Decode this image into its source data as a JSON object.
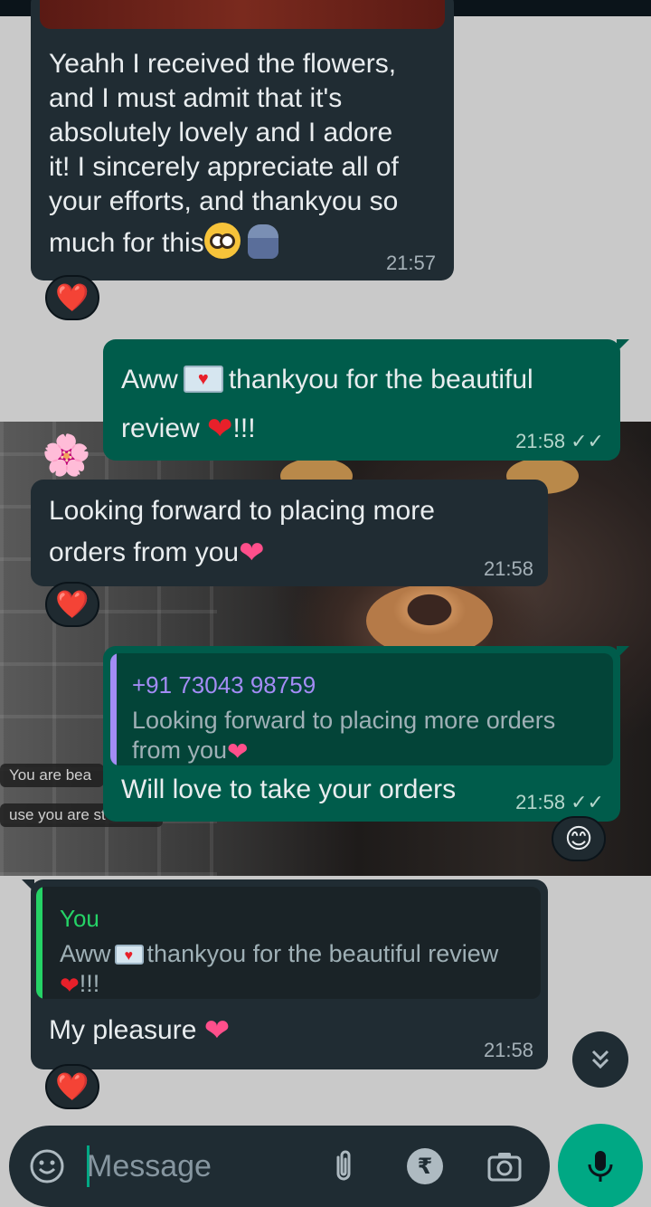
{
  "messages": [
    {
      "id": "m1",
      "direction": "incoming",
      "lines": [
        "Yeahh I received the flowers,",
        "and I must admit that it's",
        "absolutely lovely and I adore",
        "it! I sincerely appreciate all of",
        "your efforts, and thankyou so",
        "much for this"
      ],
      "time": "21:57",
      "reaction": "❤️"
    },
    {
      "id": "m2",
      "direction": "outgoing",
      "line1_pre": "Aww",
      "line1_post": "thankyou for the beautiful",
      "line2_pre": "review",
      "line2_post": "!!!",
      "time": "21:58",
      "status": "read"
    },
    {
      "id": "m3",
      "direction": "incoming",
      "line1": "Looking forward to placing more",
      "line2": "orders from you",
      "time": "21:58",
      "reaction": "❤️"
    },
    {
      "id": "m4",
      "direction": "outgoing",
      "quote_sender": "+91 73043 98759",
      "quote_line1": "Looking forward to placing more orders",
      "quote_line2": "from you",
      "text": "Will love to take your orders",
      "time": "21:58",
      "status": "read",
      "reaction": "😊"
    },
    {
      "id": "m5",
      "direction": "incoming",
      "quote_sender": "You",
      "quote_line1_pre": "Aww",
      "quote_line1_post": "thankyou for the beautiful review",
      "quote_line2": "!!!",
      "text": "My pleasure",
      "time": "21:58",
      "reaction": "❤️"
    }
  ],
  "wallpaper_stickers": [
    "You are bea",
    "use you are st"
  ],
  "composer": {
    "placeholder": "Message",
    "rupee_symbol": "₹"
  },
  "colors": {
    "incoming_bubble": "#202c33",
    "outgoing_bubble": "#005c4b",
    "accent": "#00a884",
    "quote_phone": "#a38cf5",
    "quote_you": "#25d366"
  },
  "icons": [
    "emoji-icon",
    "attach-icon",
    "rupee-icon",
    "camera-icon",
    "mic-icon",
    "scroll-down-icon",
    "read-ticks-icon"
  ]
}
